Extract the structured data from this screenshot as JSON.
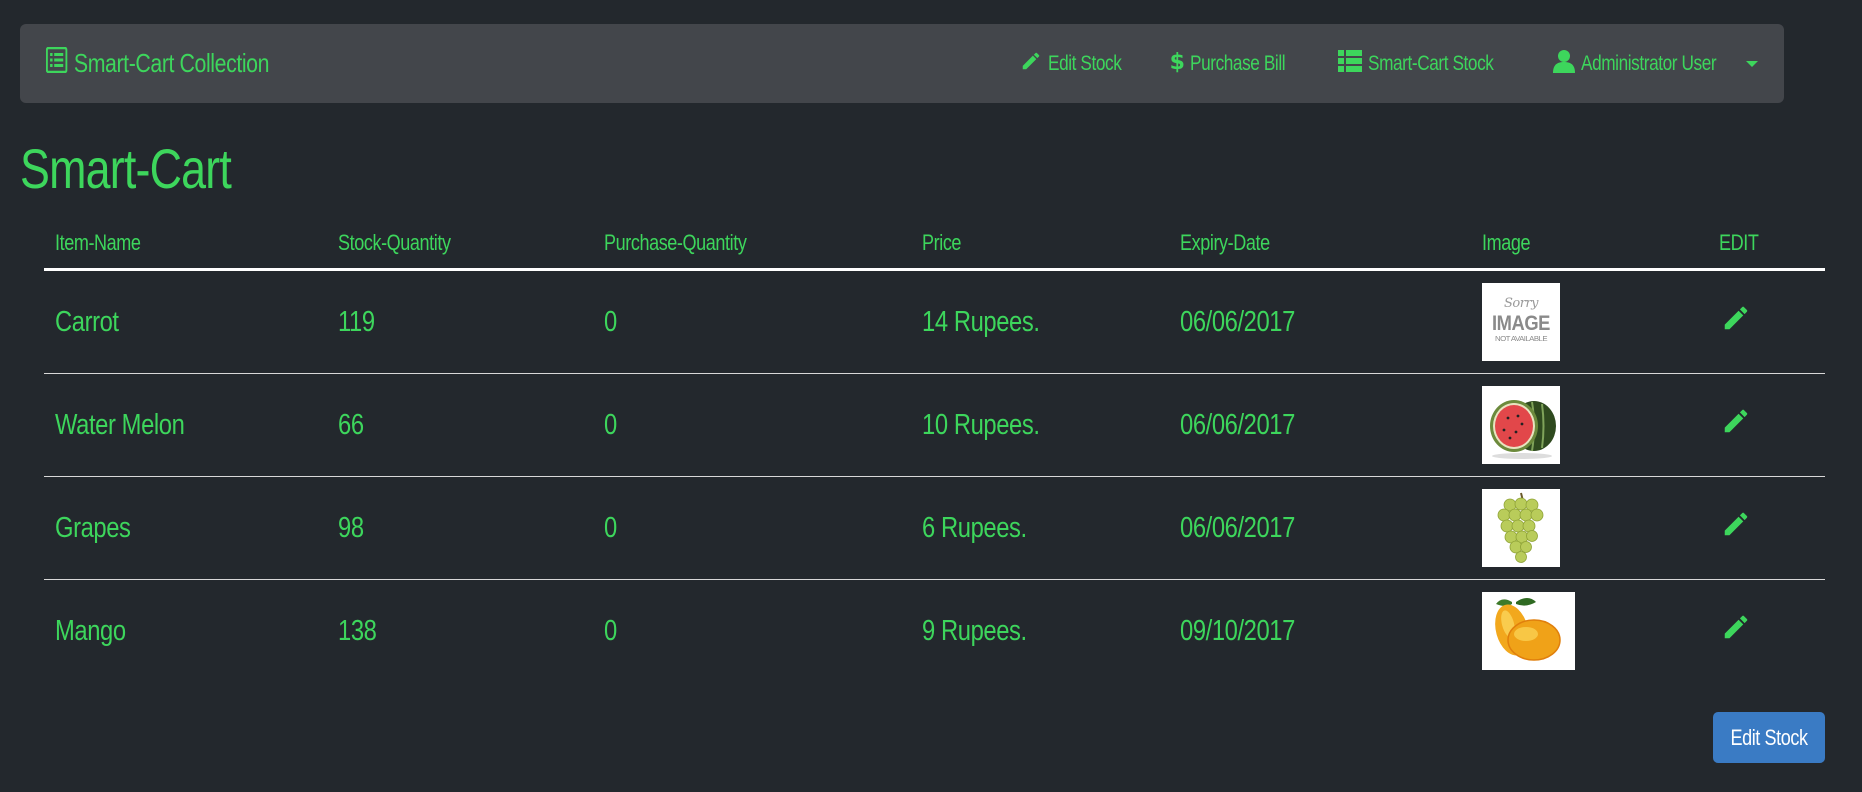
{
  "navbar": {
    "brand": "Smart-Cart Collection",
    "links": [
      {
        "label": "Edit Stock",
        "icon": "pencil-icon"
      },
      {
        "label": "Purchase Bill",
        "icon": "dollar-icon"
      },
      {
        "label": "Smart-Cart Stock",
        "icon": "table-icon"
      },
      {
        "label": "Administrator User",
        "icon": "user-icon"
      }
    ]
  },
  "page_title": "Smart-Cart",
  "table": {
    "headers": [
      "Item-Name",
      "Stock-Quantity",
      "Purchase-Quantity",
      "Price",
      "Expiry-Date",
      "Image",
      "EDIT"
    ],
    "rows": [
      {
        "name": "Carrot",
        "stock": "119",
        "purchase": "0",
        "price": "14 Rupees.",
        "expiry": "06/06/2017",
        "image": "image-not-available",
        "image_text": [
          "Sorry",
          "IMAGE",
          "NOT AVAILABLE"
        ]
      },
      {
        "name": "Water Melon",
        "stock": "66",
        "purchase": "0",
        "price": "10 Rupees.",
        "expiry": "06/06/2017",
        "image": "watermelon"
      },
      {
        "name": "Grapes",
        "stock": "98",
        "purchase": "0",
        "price": "6 Rupees.",
        "expiry": "06/06/2017",
        "image": "grapes"
      },
      {
        "name": "Mango",
        "stock": "138",
        "purchase": "0",
        "price": "9 Rupees.",
        "expiry": "09/10/2017",
        "image": "mango"
      }
    ]
  },
  "footer_button": "Edit Stock",
  "colors": {
    "background": "#23282d",
    "navbar": "#43464b",
    "accent_green": "#3dd65c",
    "button_blue": "#3a7bc4"
  }
}
